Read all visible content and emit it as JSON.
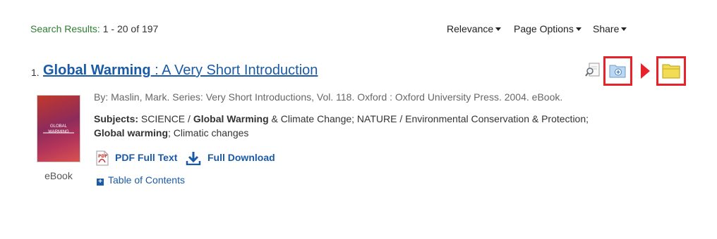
{
  "results": {
    "label": "Search Results:",
    "range": "1 - 20 of 197"
  },
  "toolbar": {
    "relevance": "Relevance",
    "page_options": "Page Options",
    "share": "Share"
  },
  "record": {
    "number": "1.",
    "title_highlight": "Global Warming",
    "title_rest": " : A Very Short Introduction",
    "cover_text": "GLOBAL WARMING",
    "cover_label": "eBook",
    "byline": "By: Maslin, Mark. Series: Very Short Introductions, Vol. 118. Oxford : Oxford University Press. 2004. eBook.",
    "subjects": {
      "label": "Subjects:",
      "part1": " SCIENCE / ",
      "hl1": "Global Warming",
      "part2": " & Climate Change; NATURE / Environmental Conservation & Protection; ",
      "hl2": "Global warming",
      "part3": "; Climatic changes"
    },
    "pdf_label": "PDF Full Text",
    "download_label": "Full Download",
    "toc_label": "Table of Contents"
  },
  "colors": {
    "link": "#1a5aa6",
    "results_label": "#2e7d32",
    "highlight_frame": "#e8222b"
  },
  "icons": [
    "preview-icon",
    "add-to-folder-icon",
    "folder-icon",
    "pdf-icon",
    "download-icon",
    "expand-plus-icon"
  ]
}
